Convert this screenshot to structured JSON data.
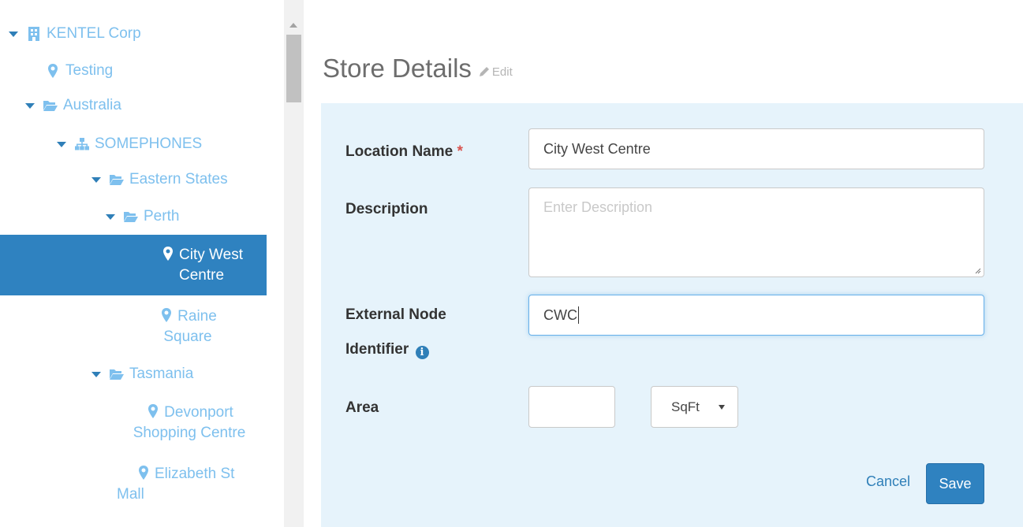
{
  "tree": [
    {
      "label": "KENTEL Corp",
      "icon": "building-icon",
      "expanded": true
    },
    {
      "label": "Testing",
      "icon": "map-marker-icon"
    },
    {
      "label": "Australia",
      "icon": "folder-open-icon",
      "expanded": true
    },
    {
      "label": "SOMEPHONES",
      "icon": "sitemap-icon",
      "expanded": true
    },
    {
      "label": "Eastern States",
      "icon": "folder-open-icon",
      "expanded": true
    },
    {
      "label": "Perth",
      "icon": "folder-open-icon",
      "expanded": true
    },
    {
      "label": "City West Centre",
      "icon": "map-marker-icon",
      "selected": true
    },
    {
      "label": "Raine Square",
      "icon": "map-marker-icon"
    },
    {
      "label": "Tasmania",
      "icon": "folder-open-icon",
      "expanded": true
    },
    {
      "label": "Devonport Shopping Centre",
      "icon": "map-marker-icon"
    },
    {
      "label": "Elizabeth St Mall",
      "icon": "map-marker-icon"
    }
  ],
  "header": {
    "title": "Store Details",
    "edit_label": "Edit"
  },
  "form": {
    "location_name": {
      "label": "Location Name",
      "required_mark": "*",
      "value": "City West Centre"
    },
    "description": {
      "label": "Description",
      "placeholder": "Enter Description",
      "value": ""
    },
    "external_node": {
      "label_line1": "External Node",
      "label_line2": "Identifier",
      "value": "CWC"
    },
    "area": {
      "label": "Area",
      "value": "",
      "unit_selected": "SqFt"
    }
  },
  "actions": {
    "cancel_label": "Cancel",
    "save_label": "Save"
  },
  "colors": {
    "accent": "#2f82c0",
    "tree_text": "#7ec0ee",
    "panel_bg": "#e6f3fb",
    "required": "#d9534f"
  }
}
